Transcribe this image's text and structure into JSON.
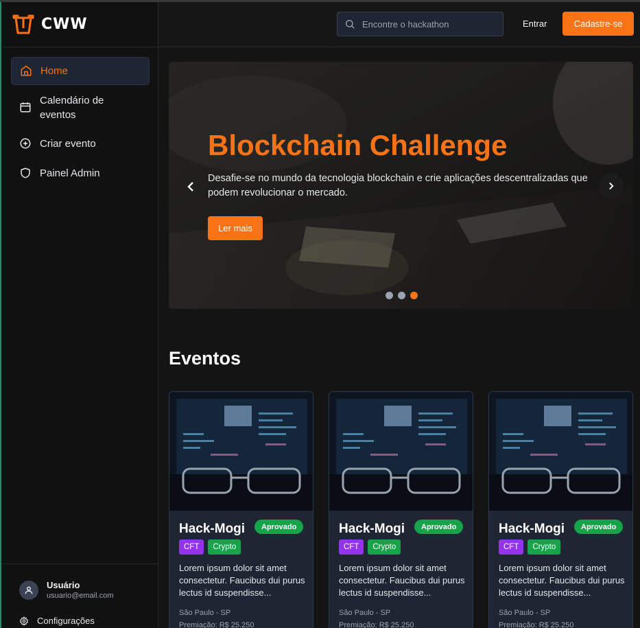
{
  "app": {
    "brand": "CWW"
  },
  "colors": {
    "accent": "#f97316",
    "success": "#16a34a",
    "tag_purple": "#9333ea",
    "surface": "#1e2533"
  },
  "sidebar": {
    "items": [
      {
        "label": "Home",
        "icon": "home-icon",
        "active": true
      },
      {
        "label": "Calendário de eventos",
        "icon": "calendar-icon",
        "active": false
      },
      {
        "label": "Criar evento",
        "icon": "plus-circle-icon",
        "active": false
      },
      {
        "label": "Painel Admin",
        "icon": "shield-icon",
        "active": false
      }
    ],
    "user": {
      "name": "Usuário",
      "email": "usuario@email.com"
    },
    "settings_label": "Configurações"
  },
  "header": {
    "search_placeholder": "Encontre o hackathon",
    "login_label": "Entrar",
    "signup_label": "Cadastre-se"
  },
  "hero": {
    "title": "Blockchain Challenge",
    "subtitle": "Desafie-se no mundo da tecnologia blockchain e crie aplicações descentralizadas que podem revolucionar o mercado.",
    "button_label": "Ler mais",
    "slides_count": 3,
    "active_slide": 3
  },
  "events": {
    "title": "Eventos",
    "cards": [
      {
        "title": "Hack-Mogi",
        "status": "Aprovado",
        "tags": [
          "CFT",
          "Crypto"
        ],
        "description": "Lorem ipsum dolor sit amet consectetur. Faucibus dui purus lectus id suspendisse...",
        "location": "São Paulo - SP",
        "prize": "Premiação: R$ 25.250"
      },
      {
        "title": "Hack-Mogi",
        "status": "Aprovado",
        "tags": [
          "CFT",
          "Crypto"
        ],
        "description": "Lorem ipsum dolor sit amet consectetur. Faucibus dui purus lectus id suspendisse...",
        "location": "São Paulo - SP",
        "prize": "Premiação: R$ 25.250"
      },
      {
        "title": "Hack-Mogi",
        "status": "Aprovado",
        "tags": [
          "CFT",
          "Crypto"
        ],
        "description": "Lorem ipsum dolor sit amet consectetur. Faucibus dui purus lectus id suspendisse...",
        "location": "São Paulo - SP",
        "prize": "Premiação: R$ 25.250"
      }
    ]
  }
}
